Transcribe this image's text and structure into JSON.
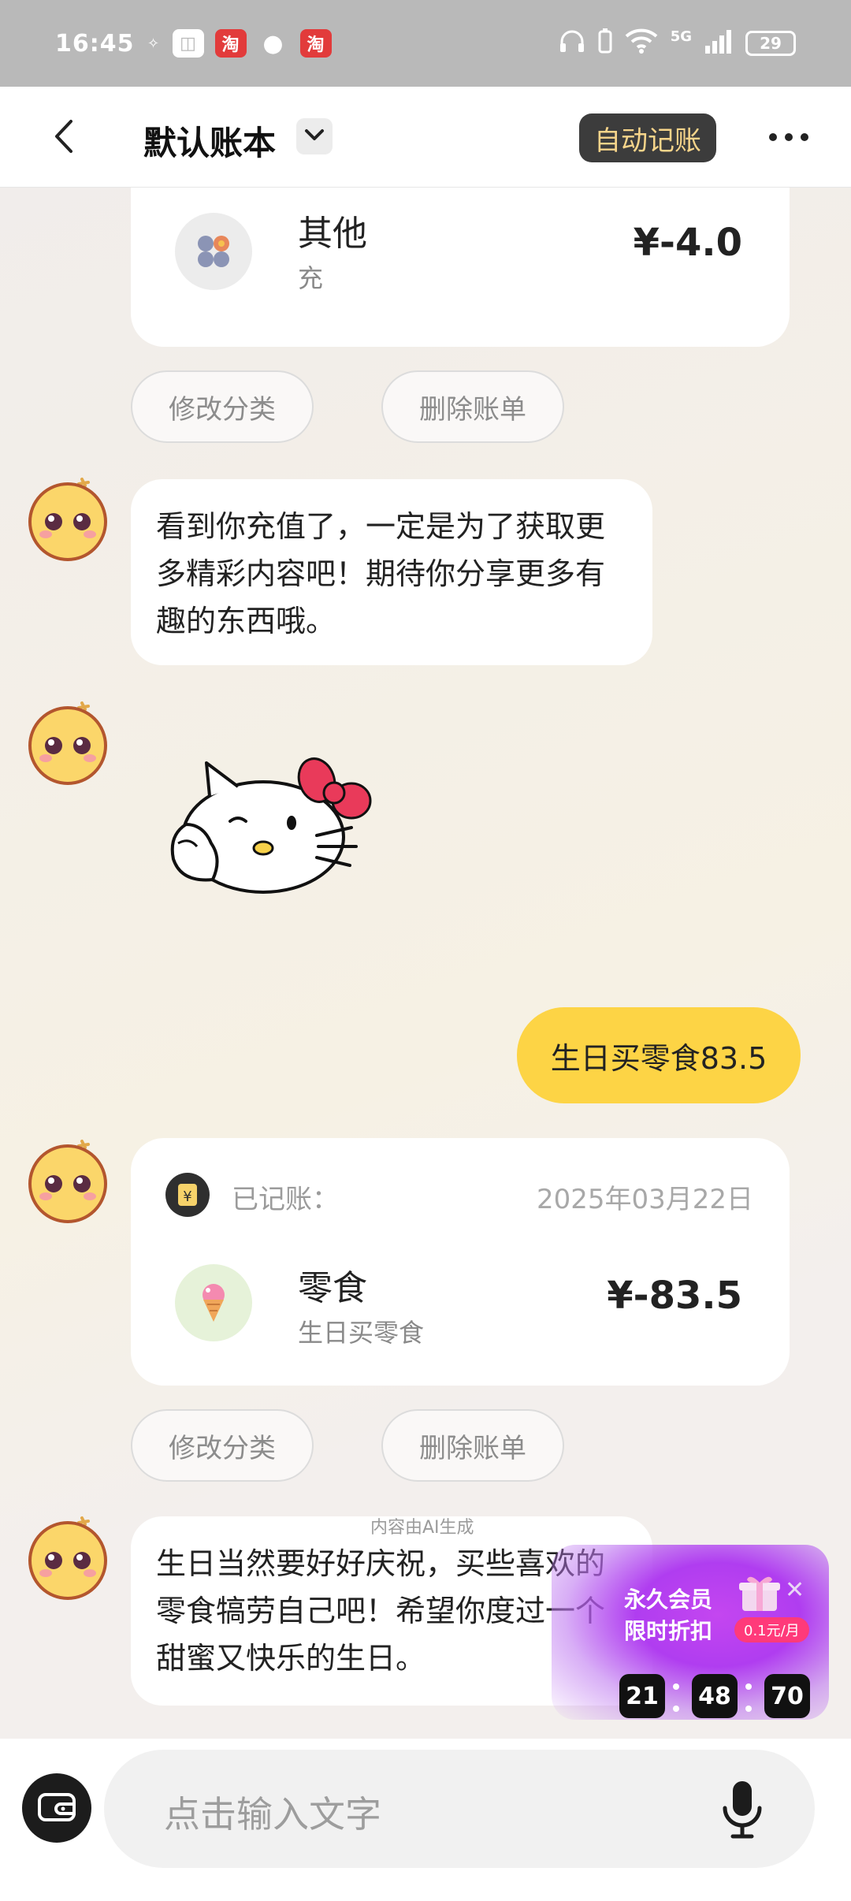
{
  "status_bar": {
    "time": "16:45",
    "network": "5G",
    "battery": "29"
  },
  "header": {
    "title": "默认账本",
    "auto_record_label": "自动记账"
  },
  "messages": {
    "record1": {
      "category": "其他",
      "note": "充",
      "amount": "¥-4.0",
      "edit_label": "修改分类",
      "delete_label": "删除账单"
    },
    "bot_reply1": "看到你充值了，一定是为了获取更多精彩内容吧！期待你分享更多有趣的东西哦。",
    "user_msg": "生日买零食83.5",
    "record2": {
      "recorded_label": "已记账：",
      "date": "2025年03月22日",
      "category": "零食",
      "note": "生日买零食",
      "amount": "¥-83.5",
      "edit_label": "修改分类",
      "delete_label": "删除账单"
    },
    "bot_reply2": "生日当然要好好庆祝，买些喜欢的零食犒劳自己吧！希望你度过一个甜蜜又快乐的生日。",
    "ai_note": "内容由AI生成"
  },
  "promo": {
    "line1": "永久会员",
    "line2": "限时折扣",
    "price": "0.1元/月",
    "timer": [
      "21",
      "48",
      "70"
    ]
  },
  "input": {
    "placeholder": "点击输入文字"
  },
  "colors": {
    "accent_yellow": "#fdd445",
    "auto_btn_text": "#f6d48a",
    "promo_purple": "#b03df0"
  }
}
